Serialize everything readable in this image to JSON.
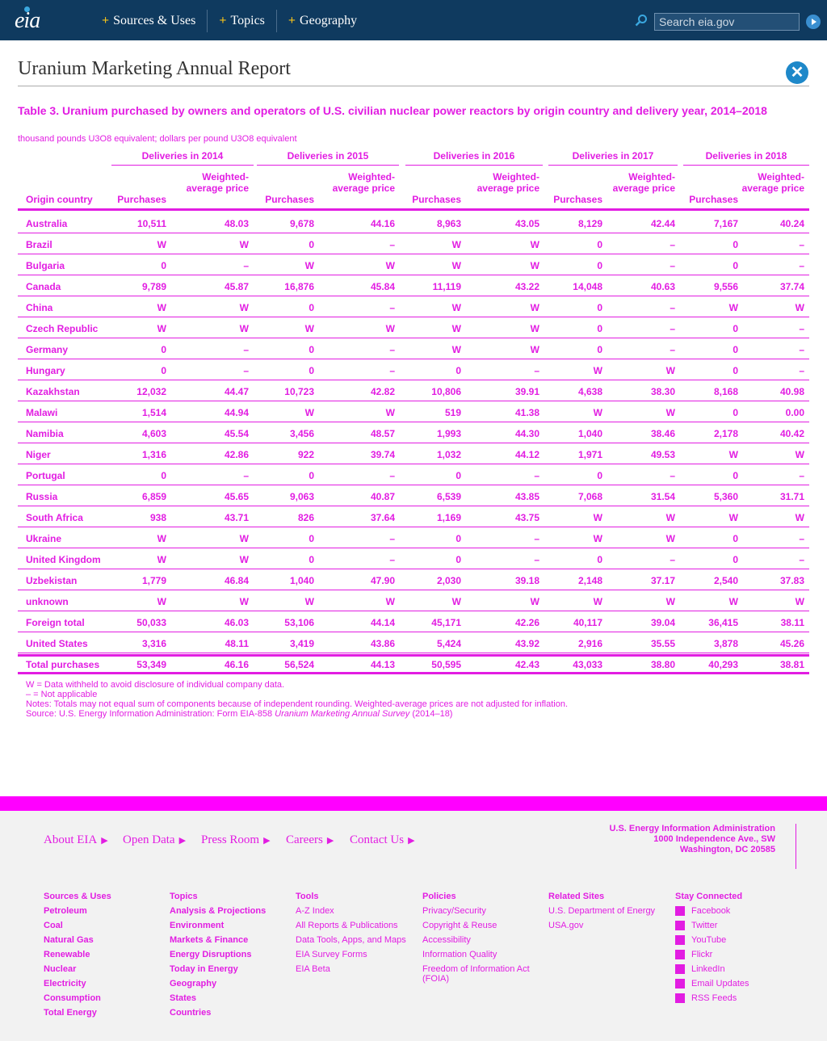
{
  "header": {
    "logo": "eia",
    "nav": [
      "Sources & Uses",
      "Topics",
      "Geography"
    ],
    "search_placeholder": "Search eia.gov"
  },
  "page_title": "Uranium Marketing Annual Report",
  "table": {
    "title": "Table 3. Uranium purchased by owners and operators of U.S. civilian nuclear power reactors by origin country and delivery year, 2014–2018",
    "subtitle": "thousand pounds U3O8 equivalent; dollars per pound U3O8 equivalent",
    "country_header": "Origin country",
    "year_headers": [
      "Deliveries in 2014",
      "Deliveries in 2015",
      "Deliveries in 2016",
      "Deliveries in 2017",
      "Deliveries in 2018"
    ],
    "purchases_label": "Purchases",
    "price_label": "Weighted-average price",
    "rows": [
      {
        "country": "Australia",
        "v": [
          "10,511",
          "48.03",
          "9,678",
          "44.16",
          "8,963",
          "43.05",
          "8,129",
          "42.44",
          "7,167",
          "40.24"
        ]
      },
      {
        "country": "Brazil",
        "v": [
          "W",
          "W",
          "0",
          "–",
          "W",
          "W",
          "0",
          "–",
          "0",
          "–"
        ]
      },
      {
        "country": "Bulgaria",
        "v": [
          "0",
          "–",
          "W",
          "W",
          "W",
          "W",
          "0",
          "–",
          "0",
          "–"
        ]
      },
      {
        "country": "Canada",
        "v": [
          "9,789",
          "45.87",
          "16,876",
          "45.84",
          "11,119",
          "43.22",
          "14,048",
          "40.63",
          "9,556",
          "37.74"
        ]
      },
      {
        "country": "China",
        "v": [
          "W",
          "W",
          "0",
          "–",
          "W",
          "W",
          "0",
          "–",
          "W",
          "W"
        ]
      },
      {
        "country": "Czech Republic",
        "v": [
          "W",
          "W",
          "W",
          "W",
          "W",
          "W",
          "0",
          "–",
          "0",
          "–"
        ]
      },
      {
        "country": "Germany",
        "v": [
          "0",
          "–",
          "0",
          "–",
          "W",
          "W",
          "0",
          "–",
          "0",
          "–"
        ]
      },
      {
        "country": "Hungary",
        "v": [
          "0",
          "–",
          "0",
          "–",
          "0",
          "–",
          "W",
          "W",
          "0",
          "–"
        ]
      },
      {
        "country": "Kazakhstan",
        "v": [
          "12,032",
          "44.47",
          "10,723",
          "42.82",
          "10,806",
          "39.91",
          "4,638",
          "38.30",
          "8,168",
          "40.98"
        ]
      },
      {
        "country": "Malawi",
        "v": [
          "1,514",
          "44.94",
          "W",
          "W",
          "519",
          "41.38",
          "W",
          "W",
          "0",
          "0.00"
        ]
      },
      {
        "country": "Namibia",
        "v": [
          "4,603",
          "45.54",
          "3,456",
          "48.57",
          "1,993",
          "44.30",
          "1,040",
          "38.46",
          "2,178",
          "40.42"
        ]
      },
      {
        "country": "Niger",
        "v": [
          "1,316",
          "42.86",
          "922",
          "39.74",
          "1,032",
          "44.12",
          "1,971",
          "49.53",
          "W",
          "W"
        ]
      },
      {
        "country": "Portugal",
        "v": [
          "0",
          "–",
          "0",
          "–",
          "0",
          "–",
          "0",
          "–",
          "0",
          "–"
        ]
      },
      {
        "country": "Russia",
        "v": [
          "6,859",
          "45.65",
          "9,063",
          "40.87",
          "6,539",
          "43.85",
          "7,068",
          "31.54",
          "5,360",
          "31.71"
        ]
      },
      {
        "country": "South Africa",
        "v": [
          "938",
          "43.71",
          "826",
          "37.64",
          "1,169",
          "43.75",
          "W",
          "W",
          "W",
          "W"
        ]
      },
      {
        "country": "Ukraine",
        "v": [
          "W",
          "W",
          "0",
          "–",
          "0",
          "–",
          "W",
          "W",
          "0",
          "–"
        ]
      },
      {
        "country": "United Kingdom",
        "v": [
          "W",
          "W",
          "0",
          "–",
          "0",
          "–",
          "0",
          "–",
          "0",
          "–"
        ]
      },
      {
        "country": "Uzbekistan",
        "v": [
          "1,779",
          "46.84",
          "1,040",
          "47.90",
          "2,030",
          "39.18",
          "2,148",
          "37.17",
          "2,540",
          "37.83"
        ]
      },
      {
        "country": "unknown",
        "v": [
          "W",
          "W",
          "W",
          "W",
          "W",
          "W",
          "W",
          "W",
          "W",
          "W"
        ]
      },
      {
        "country": "Foreign total",
        "v": [
          "50,033",
          "46.03",
          "53,106",
          "44.14",
          "45,171",
          "42.26",
          "40,117",
          "39.04",
          "36,415",
          "38.11"
        ]
      },
      {
        "country": "United States",
        "v": [
          "3,316",
          "48.11",
          "3,419",
          "43.86",
          "5,424",
          "43.92",
          "2,916",
          "35.55",
          "3,878",
          "45.26"
        ]
      }
    ],
    "total": {
      "country": "Total purchases",
      "v": [
        "53,349",
        "46.16",
        "56,524",
        "44.13",
        "50,595",
        "42.43",
        "43,033",
        "38.80",
        "40,293",
        "38.81"
      ]
    },
    "notes": {
      "w": "W = Data withheld to avoid disclosure of individual company data.",
      "na": "– = Not applicable",
      "notes": "Notes: Totals may not equal sum of components because of independent rounding. Weighted-average prices are not adjusted for inflation.",
      "source_prefix": "Source: U.S. Energy Information Administration: Form EIA-858 ",
      "source_italic": "Uranium Marketing Annual Survey",
      "source_suffix": " (2014–18)"
    }
  },
  "footer": {
    "top_links": [
      "About EIA",
      "Open Data",
      "Press Room",
      "Careers",
      "Contact Us"
    ],
    "address": [
      "U.S. Energy Information Administration",
      "1000 Independence Ave., SW",
      "Washington, DC 20585"
    ],
    "columns": [
      {
        "heading": "Sources & Uses",
        "items": [
          "Petroleum",
          "Coal",
          "Natural Gas",
          "Renewable",
          "Nuclear",
          "Electricity",
          "Consumption",
          "Total Energy"
        ]
      },
      {
        "heading": "Topics",
        "items": [
          "Analysis & Projections",
          "Environment",
          "Markets & Finance",
          "Energy Disruptions",
          "Today in Energy",
          "Geography",
          "States",
          "Countries"
        ]
      },
      {
        "heading": "Tools",
        "items": [
          "A-Z Index",
          "All Reports & Publications",
          "Data Tools, Apps, and Maps",
          "EIA Survey Forms",
          "EIA Beta"
        ]
      },
      {
        "heading": "Policies",
        "items": [
          "Privacy/Security",
          "Copyright & Reuse",
          "Accessibility",
          "Information Quality",
          "Freedom of Information Act (FOIA)"
        ]
      },
      {
        "heading": "Related Sites",
        "items": [
          "U.S. Department of Energy",
          "USA.gov"
        ]
      },
      {
        "heading": "Stay Connected",
        "items": [
          "Facebook",
          "Twitter",
          "YouTube",
          "Flickr",
          "LinkedIn",
          "Email Updates",
          "RSS Feeds"
        ]
      }
    ]
  }
}
